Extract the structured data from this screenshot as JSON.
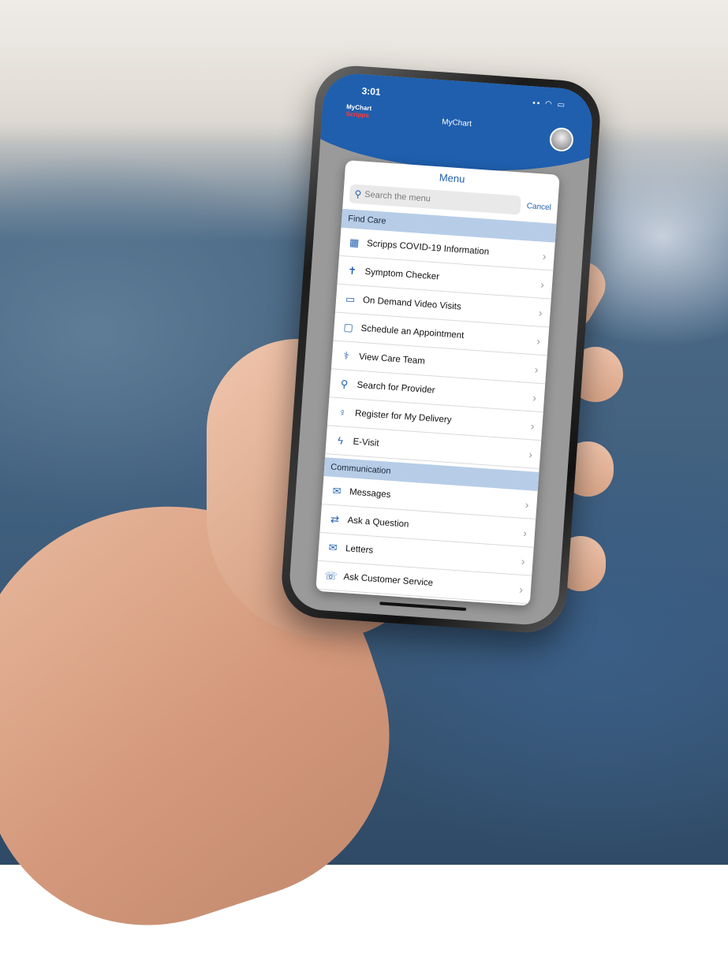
{
  "status_bar": {
    "time": "3:01",
    "icons": "▪▪ ◠ ▭"
  },
  "header": {
    "logo_line1": "MyChart",
    "logo_line2": "Scripps",
    "title": "MyChart"
  },
  "menu": {
    "title": "Menu",
    "search_placeholder": "Search the menu",
    "cancel_label": "Cancel",
    "sections": [
      {
        "title": "Find Care",
        "items": [
          {
            "icon": "document-icon",
            "glyph": "▦",
            "label": "Scripps COVID-19 Information"
          },
          {
            "icon": "person-icon",
            "glyph": "✝",
            "label": "Symptom Checker"
          },
          {
            "icon": "laptop-icon",
            "glyph": "▭",
            "label": "On Demand Video Visits"
          },
          {
            "icon": "calendar-icon",
            "glyph": "▢",
            "label": "Schedule an Appointment"
          },
          {
            "icon": "care-team-icon",
            "glyph": "⚕",
            "label": "View Care Team"
          },
          {
            "icon": "search-icon",
            "glyph": "⚲",
            "label": "Search for Provider"
          },
          {
            "icon": "pregnancy-icon",
            "glyph": "♀",
            "label": "Register for My Delivery"
          },
          {
            "icon": "stethoscope-icon",
            "glyph": "ϟ",
            "label": "E-Visit"
          }
        ]
      },
      {
        "title": "Communication",
        "items": [
          {
            "icon": "envelope-icon",
            "glyph": "✉",
            "label": "Messages"
          },
          {
            "icon": "question-icon",
            "glyph": "⇄",
            "label": "Ask a Question"
          },
          {
            "icon": "letter-icon",
            "glyph": "✉",
            "label": "Letters"
          },
          {
            "icon": "customer-service-icon",
            "glyph": "☏",
            "label": "Ask Customer Service"
          }
        ]
      }
    ]
  }
}
